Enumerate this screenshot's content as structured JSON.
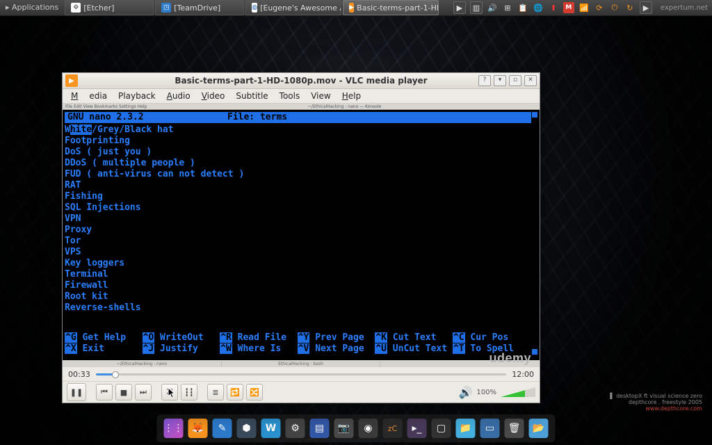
{
  "panel": {
    "applications_label": "Applications",
    "tasks": [
      {
        "label": "[Etcher]"
      },
      {
        "label": "[TeamDrive]"
      },
      {
        "label": "[Eugene's Awesome A..."
      },
      {
        "label": "Basic-terms-part-1-HD..."
      }
    ],
    "session_label": "expertum.net"
  },
  "vlc": {
    "title": "Basic-terms-part-1-HD-1080p.mov - VLC media player",
    "menus": [
      "Media",
      "Playback",
      "Audio",
      "Video",
      "Subtitle",
      "Tools",
      "View",
      "Help"
    ],
    "time_elapsed": "00:33",
    "time_total": "12:00",
    "volume_pct": "100%",
    "seek_fill_pct": "4.6%"
  },
  "term_title_bar": {
    "left": "File Edit View Bookmarks Settings Help",
    "center": "~/EthicalHacking : nano — Konsole"
  },
  "nano": {
    "version": "GNU nano 2.3.2",
    "file_label": "File: terms",
    "watermark": "udemy",
    "lines_prefix_plain": "W",
    "lines_selected": "hite",
    "lines_rest_first": "/Grey/Black hat",
    "lines": [
      "Footprinting",
      "DoS ( just you )",
      "DDoS ( multiple people )",
      "FUD ( anti-virus can not detect )",
      "RAT",
      "Fishing",
      "SQL Injections",
      "VPN",
      "Proxy",
      "Tor",
      "VPS",
      "Key loggers",
      "Terminal",
      "Firewall",
      "Root kit",
      "Reverse-shells"
    ],
    "help": [
      {
        "k": "^G",
        "t": "Get Help"
      },
      {
        "k": "^O",
        "t": "WriteOut"
      },
      {
        "k": "^R",
        "t": "Read File"
      },
      {
        "k": "^Y",
        "t": "Prev Page"
      },
      {
        "k": "^K",
        "t": "Cut Text"
      },
      {
        "k": "^C",
        "t": "Cur Pos"
      },
      {
        "k": "^X",
        "t": "Exit"
      },
      {
        "k": "^J",
        "t": "Justify"
      },
      {
        "k": "^W",
        "t": "Where Is"
      },
      {
        "k": "^V",
        "t": "Next Page"
      },
      {
        "k": "^U",
        "t": "UnCut Text"
      },
      {
        "k": "^T",
        "t": "To Spell"
      }
    ]
  },
  "taskstrip": {
    "items": [
      "~/EthicalHacking : nano",
      "EthicalHacking : bash",
      ""
    ]
  },
  "credit": {
    "line1": "desktopX ft visual science zero",
    "line2": "depthcore . freestyle    2005",
    "site": "www.depthcore.com"
  },
  "dock_icons": [
    "apps",
    "ff",
    "note",
    "hex",
    "hex2",
    "gear",
    "book",
    "cam",
    "disc",
    "zC",
    "term",
    "term2",
    "files",
    "tray",
    "trash",
    "folder"
  ]
}
